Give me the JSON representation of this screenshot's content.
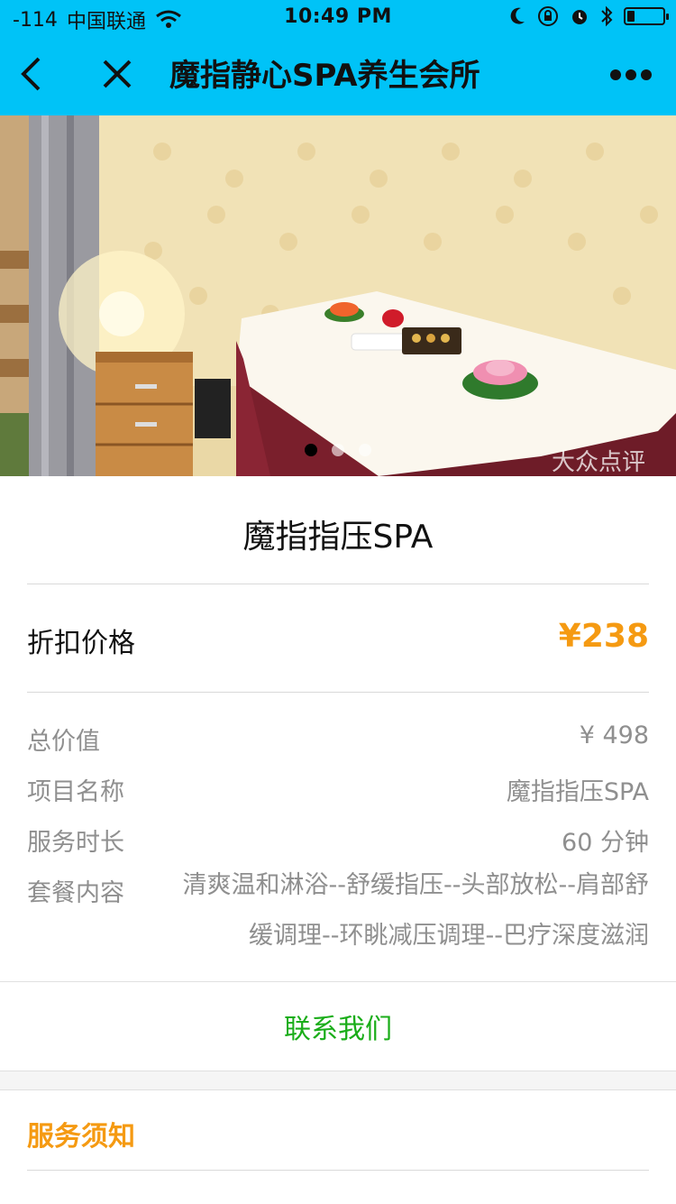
{
  "status_bar": {
    "signal": "-114",
    "carrier": "中国联通",
    "time": "10:49 PM",
    "icons": [
      "wifi-icon",
      "moon-icon",
      "rotation-lock-icon",
      "alarm-icon",
      "bluetooth-icon",
      "battery-icon"
    ],
    "battery_level": 0.2
  },
  "nav": {
    "title": "魔指静心SPA养生会所",
    "icons": [
      "back-icon",
      "close-icon",
      "more-icon"
    ]
  },
  "carousel": {
    "slide_count": 3,
    "active_index": 0,
    "watermark": "大众点评"
  },
  "product": {
    "title": "魔指指压SPA",
    "price_label": "折扣价格",
    "price_value": "¥238"
  },
  "details": {
    "total_value_label": "总价值",
    "total_value": "¥ 498",
    "project_name_label": "项目名称",
    "project_name": "魔指指压SPA",
    "duration_label": "服务时长",
    "duration": "60 分钟",
    "package_label": "套餐内容",
    "package_content": "清爽温和淋浴--舒缓指压--头部放松--肩部舒缓调理--环眺减压调理--巴疗深度滋润"
  },
  "contact": {
    "label": "联系我们"
  },
  "notice": {
    "title": "服务须知"
  },
  "colors": {
    "nav_bg": "#00c3f7",
    "price": "#f59a12",
    "contact": "#1aad19"
  }
}
